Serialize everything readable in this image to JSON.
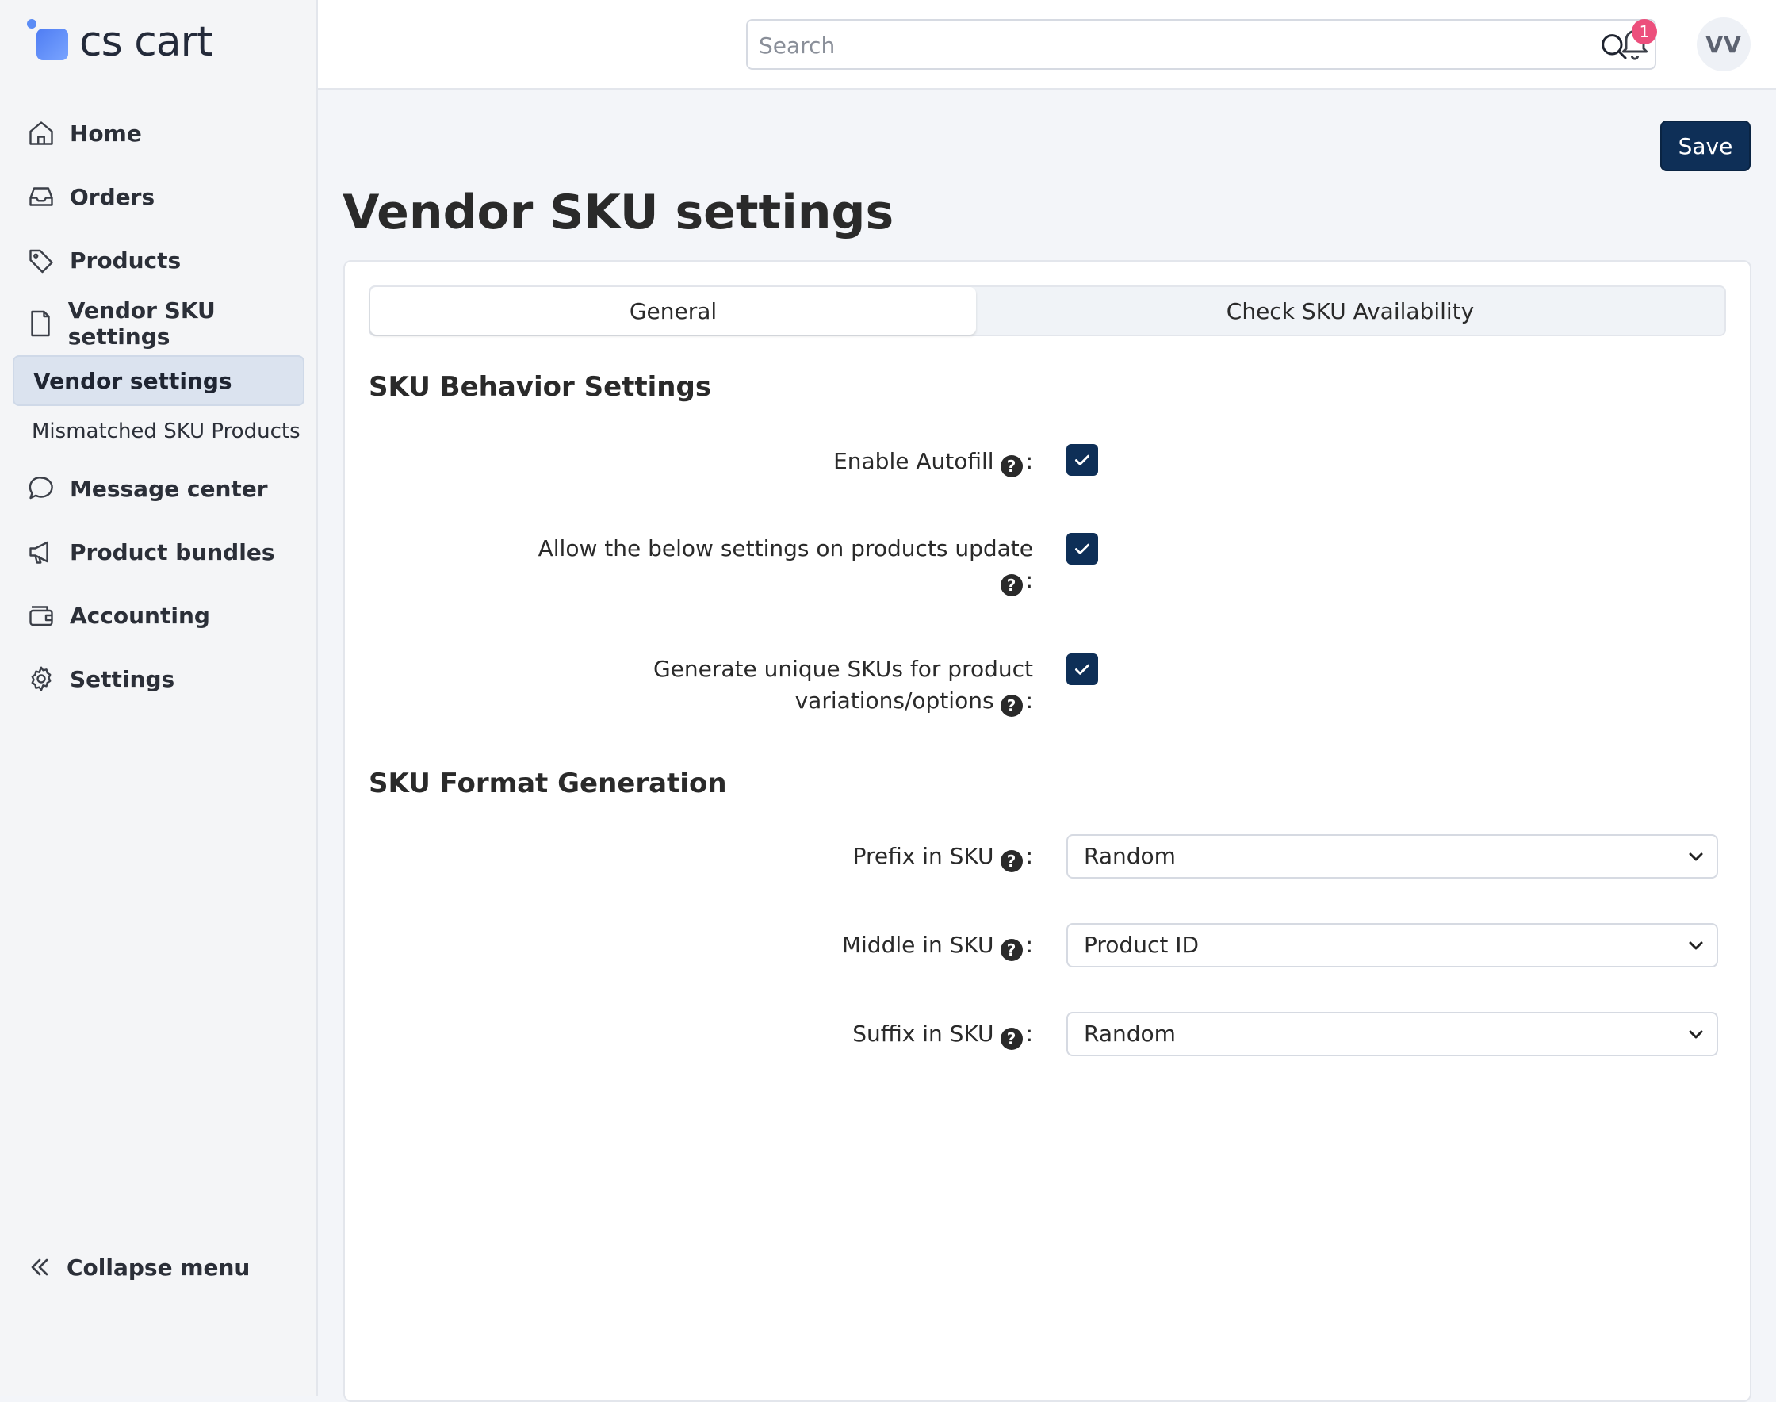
{
  "brand": {
    "name": "cs cart"
  },
  "sidebar": {
    "items": [
      {
        "label": "Home",
        "icon": "home-icon"
      },
      {
        "label": "Orders",
        "icon": "inbox-icon"
      },
      {
        "label": "Products",
        "icon": "tag-icon"
      },
      {
        "label": "Vendor SKU settings",
        "icon": "document-icon"
      }
    ],
    "subitems": [
      {
        "label": "Vendor settings",
        "active": true
      },
      {
        "label": "Mismatched SKU Products",
        "active": false
      }
    ],
    "items_after": [
      {
        "label": "Message center",
        "icon": "chat-bubble-icon"
      },
      {
        "label": "Product bundles",
        "icon": "megaphone-icon"
      },
      {
        "label": "Accounting",
        "icon": "wallet-icon"
      },
      {
        "label": "Settings",
        "icon": "gear-icon"
      }
    ],
    "collapse_label": "Collapse menu"
  },
  "topbar": {
    "search_placeholder": "Search",
    "notifications_count": "1",
    "avatar_initials": "VV"
  },
  "page": {
    "title": "Vendor SKU settings",
    "save_label": "Save",
    "tabs": [
      {
        "label": "General",
        "active": true
      },
      {
        "label": "Check SKU Availability",
        "active": false
      }
    ],
    "sections": {
      "behavior_title": "SKU Behavior Settings",
      "format_title": "SKU Format Generation"
    },
    "behavior_fields": [
      {
        "label": "Enable Autofill",
        "checked": true
      },
      {
        "label_line1": "Allow the below settings on products update",
        "checked": true
      },
      {
        "label_line1": "Generate unique SKUs for product",
        "label_line2": "variations/options",
        "checked": true
      }
    ],
    "format_fields": [
      {
        "label": "Prefix in SKU",
        "value": "Random"
      },
      {
        "label": "Middle in SKU",
        "value": "Product ID"
      },
      {
        "label": "Suffix in SKU",
        "value": "Random"
      }
    ]
  },
  "colors": {
    "primary": "#0e2f57",
    "badge": "#ec4f7c",
    "active_nav_bg": "#dbe3ef"
  }
}
